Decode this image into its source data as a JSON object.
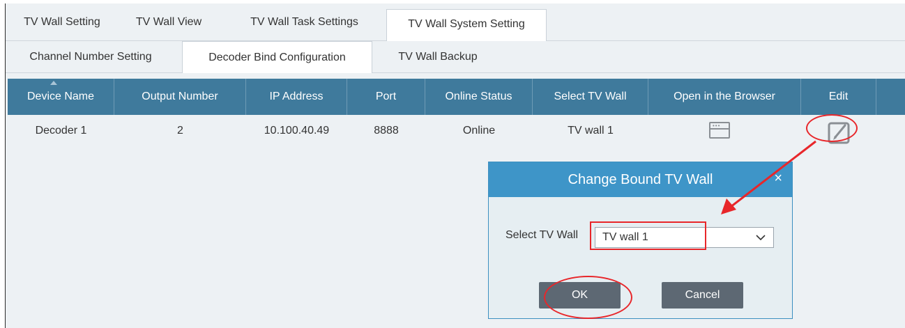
{
  "tabs": [
    {
      "label": "TV Wall Setting"
    },
    {
      "label": "TV Wall View"
    },
    {
      "label": "TV Wall Task Settings"
    },
    {
      "label": "TV Wall System Setting"
    }
  ],
  "subtabs": [
    {
      "label": "Channel Number Setting"
    },
    {
      "label": "Decoder Bind Configuration"
    },
    {
      "label": "TV Wall Backup"
    }
  ],
  "table": {
    "columns": [
      "Device Name",
      "Output Number",
      "IP Address",
      "Port",
      "Online Status",
      "Select TV Wall",
      "Open in the Browser",
      "Edit"
    ],
    "rows": [
      {
        "device_name": "Decoder 1",
        "output_number": "2",
        "ip_address": "10.100.40.49",
        "port": "8888",
        "online_status": "Online",
        "tv_wall": "TV wall 1"
      }
    ]
  },
  "icons": {
    "browser": "browser-window-icon",
    "edit": "edit-pencil-icon",
    "close": "close-icon",
    "dropdown": "chevron-down-icon"
  },
  "dialog": {
    "title": "Change Bound TV Wall",
    "close_glyph": "×",
    "select_label": "Select TV Wall",
    "select_value": "TV wall 1",
    "ok_label": "OK",
    "cancel_label": "Cancel"
  },
  "colors": {
    "header_bg": "#3f7a9c",
    "dialog_title_bg": "#3e95c8",
    "annotation_red": "#e8262a",
    "button_bg": "#5d6873"
  }
}
